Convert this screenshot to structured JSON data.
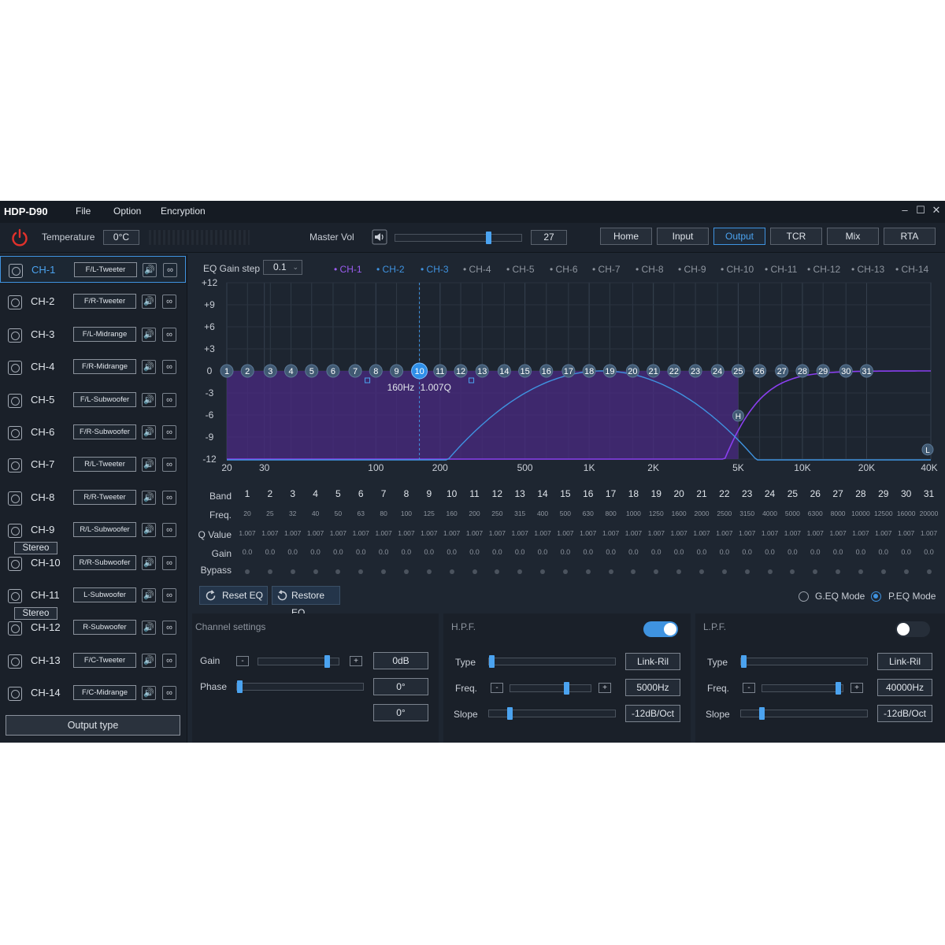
{
  "app": {
    "title": "HDP-D90",
    "menu": [
      "File",
      "Option",
      "Encryption"
    ],
    "window_controls": [
      "–",
      "☐",
      "✕"
    ]
  },
  "toolbar": {
    "temperature_label": "Temperature",
    "temperature_value": "0°C",
    "master_vol_label": "Master Vol",
    "master_vol_value": "27",
    "master_vol_fraction": 0.75,
    "nav": [
      "Home",
      "Input",
      "Output",
      "TCR",
      "Mix",
      "RTA"
    ],
    "active_nav": "Output"
  },
  "channels": [
    {
      "name": "CH-1",
      "type": "F/L-Tweeter",
      "selected": true
    },
    {
      "name": "CH-2",
      "type": "F/R-Tweeter"
    },
    {
      "name": "CH-3",
      "type": "F/L-Midrange"
    },
    {
      "name": "CH-4",
      "type": "F/R-Midrange"
    },
    {
      "name": "CH-5",
      "type": "F/L-Subwoofer"
    },
    {
      "name": "CH-6",
      "type": "F/R-Subwoofer"
    },
    {
      "name": "CH-7",
      "type": "R/L-Tweeter"
    },
    {
      "name": "CH-8",
      "type": "R/R-Tweeter"
    },
    {
      "name": "CH-9",
      "type": "R/L-Subwoofer"
    },
    {
      "name": "CH-10",
      "type": "R/R-Subwoofer"
    },
    {
      "name": "CH-11",
      "type": "L-Subwoofer"
    },
    {
      "name": "CH-12",
      "type": "R-Subwoofer"
    },
    {
      "name": "CH-13",
      "type": "F/C-Tweeter"
    },
    {
      "name": "CH-14",
      "type": "F/C-Midrange"
    }
  ],
  "stereo_label": "Stereo",
  "output_type_label": "Output type",
  "eq": {
    "gain_step_label": "EQ Gain step",
    "gain_step_value": "0.1",
    "legend": [
      "CH-1",
      "CH-2",
      "CH-3",
      "CH-4",
      "CH-5",
      "CH-6",
      "CH-7",
      "CH-8",
      "CH-9",
      "CH-10",
      "CH-11",
      "CH-12",
      "CH-13",
      "CH-14"
    ],
    "legend_colors": [
      "#9b5cf0",
      "#3f93e0",
      "#3f93e0",
      "#8e959f",
      "#8e959f",
      "#8e959f",
      "#8e959f",
      "#8e959f",
      "#8e959f",
      "#8e959f",
      "#8e959f",
      "#8e959f",
      "#8e959f",
      "#8e959f"
    ],
    "y_ticks": [
      "+12",
      "+9",
      "+6",
      "+3",
      "0",
      "-3",
      "-6",
      "-9",
      "-12"
    ],
    "y_values": [
      12,
      9,
      6,
      3,
      0,
      -3,
      -6,
      -9,
      -12
    ],
    "x_ticks": [
      "20",
      "30",
      "100",
      "200",
      "500",
      "1K",
      "2K",
      "5K",
      "10K",
      "20K",
      "40K"
    ],
    "x_values": [
      20,
      30,
      100,
      200,
      500,
      1000,
      2000,
      5000,
      10000,
      20000,
      40000
    ],
    "selected_band": 10,
    "readout_freq": "160Hz",
    "readout_q": "1.007Q",
    "hpf_marker": "H",
    "lpf_marker": "L",
    "table_labels": [
      "Band",
      "Freq.",
      "Q Value",
      "Gain",
      "Bypass"
    ],
    "bands": [
      "1",
      "2",
      "3",
      "4",
      "5",
      "6",
      "7",
      "8",
      "9",
      "10",
      "11",
      "12",
      "13",
      "14",
      "15",
      "16",
      "17",
      "18",
      "19",
      "20",
      "21",
      "22",
      "23",
      "24",
      "25",
      "26",
      "27",
      "28",
      "29",
      "30",
      "31"
    ],
    "freqs": [
      "20",
      "25",
      "32",
      "40",
      "50",
      "63",
      "80",
      "100",
      "125",
      "160",
      "200",
      "250",
      "315",
      "400",
      "500",
      "630",
      "800",
      "1000",
      "1250",
      "1600",
      "2000",
      "2500",
      "3150",
      "4000",
      "5000",
      "6300",
      "8000",
      "10000",
      "12500",
      "16000",
      "20000"
    ],
    "q_value": "1.007",
    "gain_value": "0.0",
    "reset_label": "Reset EQ",
    "restore_label": "Restore EQ",
    "geq_label": "G.EQ Mode",
    "peq_label": "P.EQ Mode",
    "mode_selected": "P.EQ Mode",
    "colors": {
      "accent": "#3f93e0",
      "fill": "#4a2a82",
      "purple_curve": "#8a3ff0"
    }
  },
  "channel_settings": {
    "title": "Channel settings",
    "gain_label": "Gain",
    "gain_value": "0dB",
    "gain_fraction": 0.88,
    "phase_label": "Phase",
    "phase_value": "0°",
    "phase_fraction": 0.0,
    "extra_value": "0°",
    "minus": "-",
    "plus": "+"
  },
  "hpf": {
    "title": "H.P.F.",
    "enabled": true,
    "type_label": "Type",
    "type_value": "Link-Ril",
    "freq_label": "Freq.",
    "freq_value": "5000Hz",
    "freq_fraction": 0.72,
    "slope_label": "Slope",
    "slope_value": "-12dB/Oct",
    "slope_fraction": 0.15
  },
  "lpf": {
    "title": "L.P.F.",
    "enabled": false,
    "type_label": "Type",
    "type_value": "Link-Ril",
    "freq_label": "Freq.",
    "freq_value": "40000Hz",
    "freq_fraction": 0.98,
    "slope_label": "Slope",
    "slope_value": "-12dB/Oct",
    "slope_fraction": 0.15
  }
}
